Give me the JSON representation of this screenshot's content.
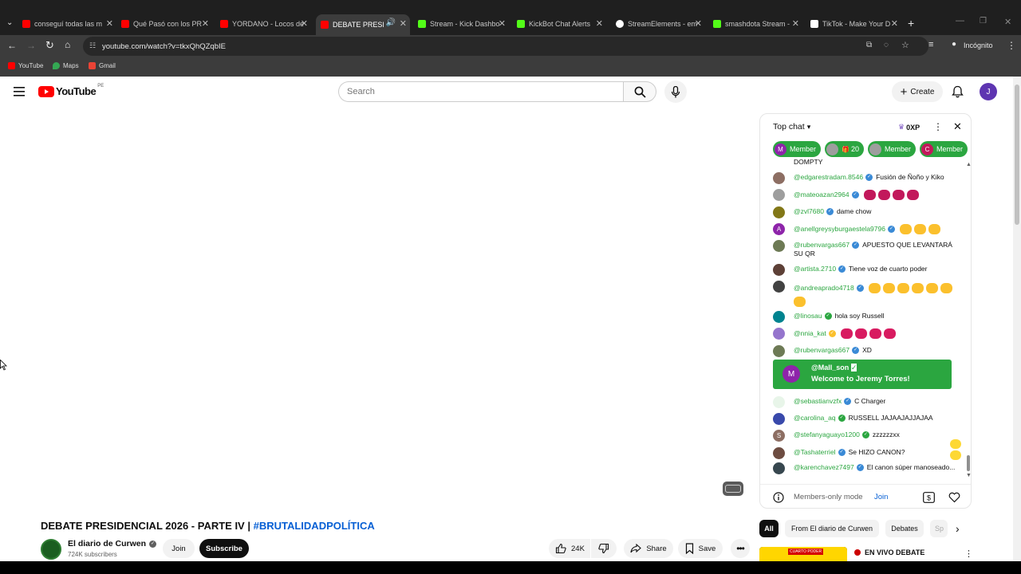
{
  "browser": {
    "tabs": [
      {
        "title": "conseguí todas las m",
        "favicon_color": "#ff0000"
      },
      {
        "title": "Qué Pasó con los PR",
        "favicon_color": "#ff0000"
      },
      {
        "title": "YORDANO - Locos de",
        "favicon_color": "#ff0000"
      },
      {
        "title": "DEBATE PRESIDE",
        "favicon_color": "#ff0000"
      },
      {
        "title": "Stream - Kick Dashbo",
        "favicon_color": "#53fc18"
      },
      {
        "title": "KickBot Chat Alerts",
        "favicon_color": "#53fc18"
      },
      {
        "title": "StreamElements - em",
        "favicon_color": "#ffffff"
      },
      {
        "title": "smashdota Stream -",
        "favicon_color": "#53fc18"
      },
      {
        "title": "TikTok - Make Your D",
        "favicon_color": "#ffffff"
      }
    ],
    "url": "youtube.com/watch?v=tkxQhQZqbIE",
    "incognito_label": "Incógnito",
    "bookmarks": [
      "YouTube",
      "Maps",
      "Gmail"
    ]
  },
  "youtube": {
    "logo_text": "YouTube",
    "region": "PE",
    "search_placeholder": "Search",
    "create_label": "Create",
    "account_initial": "J"
  },
  "video": {
    "title": "DEBATE PRESIDENCIAL 2026 - PARTE IV |",
    "hashtag": "#BRUTALIDADPOLÍTICA",
    "channel_name": "El diario de Curwen",
    "subscribers": "724K subscribers",
    "join_label": "Join",
    "subscribe_label": "Subscribe",
    "likes": "24K",
    "share_label": "Share",
    "save_label": "Save"
  },
  "chat": {
    "mode_label": "Top chat",
    "xp_label": "0XP",
    "chips": [
      {
        "label": "Member",
        "avatar": "M",
        "avatar_color": "#8e24aa"
      },
      {
        "label": "20",
        "avatar": "",
        "avatar_color": "#9e9e9e"
      },
      {
        "label": "Member",
        "avatar": "",
        "avatar_color": "#9e9e9e"
      },
      {
        "label": "Member",
        "avatar": "C",
        "avatar_color": "#c2185b"
      }
    ],
    "truncated_top": "DOMPTY",
    "messages": [
      {
        "author": "@edgarestradam.8546",
        "text": "Fusión de Ñoño y Kiko",
        "avatar_color": "#8d6e63"
      },
      {
        "author": "@mateoazan2964",
        "text": "",
        "avatar_color": "#9e9e9e",
        "emoji_count": 4
      },
      {
        "author": "@zvl7680",
        "text": "dame chow",
        "avatar_color": "#827717"
      },
      {
        "author": "@anellgreysyburgaestela9796",
        "text": "",
        "avatar_color": "#8e24aa",
        "avatar_letter": "A",
        "emoji_count": 3
      },
      {
        "author": "@rubenvargas667",
        "text": "APUESTO QUE LEVANTARÁ SU QR",
        "avatar_color": "#6d7a55"
      },
      {
        "author": "@artista.2710",
        "text": "Tiene voz de cuarto poder",
        "avatar_color": "#5d4037"
      },
      {
        "author": "@andreaprado4718",
        "text": "",
        "avatar_color": "#424242",
        "emoji_count": 7
      },
      {
        "author": "@linosau",
        "text": "hola soy Russell",
        "avatar_color": "#00838f"
      },
      {
        "author": "@nnia_kat",
        "text": "",
        "avatar_color": "#9575cd",
        "emoji_count": 4
      },
      {
        "author": "@rubenvargas667",
        "text": "XD",
        "avatar_color": "#6d7a55"
      },
      {
        "author": "@sebastianvzfx",
        "text": "C Charger",
        "avatar_color": "#e8f5e9"
      },
      {
        "author": "@carolina_aq",
        "text": "RUSSELL JAJAAJAJJAJAA",
        "avatar_color": "#3949ab"
      },
      {
        "author": "@stefanyaguayo1200",
        "text": "zzzzzzxx",
        "avatar_color": "#8d6e63",
        "avatar_letter": "S"
      },
      {
        "author": "@Tashaterriel",
        "text": "Se HIZO CANON?",
        "avatar_color": "#6d4c41"
      },
      {
        "author": "@karenchavez7497",
        "text": "El canon súper manoseado...",
        "avatar_color": "#37474f"
      }
    ],
    "welcome": {
      "author": "@Mall_son",
      "avatar": "M",
      "text": "Welcome to Jeremy Torres!"
    },
    "footer_mode": "Members-only mode",
    "footer_join": "Join"
  },
  "filters": [
    "All",
    "From El diario de Curwen",
    "Debates",
    "Sp"
  ],
  "related": {
    "title": "EN VIVO DEBATE",
    "thumb_label": "CUARTO PODER"
  },
  "colors": {
    "accent_green": "#2ba640",
    "link_blue": "#065fd4",
    "yt_red": "#ff0000"
  }
}
